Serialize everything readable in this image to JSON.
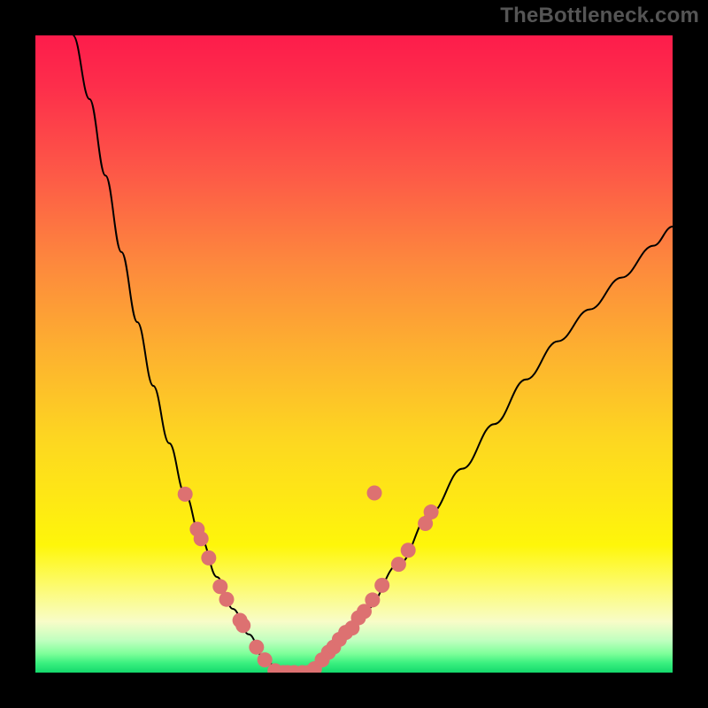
{
  "watermark": {
    "text": "TheBottleneck.com"
  },
  "chart_data": {
    "type": "line",
    "title": "",
    "xlabel": "",
    "ylabel": "",
    "ylim": [
      0,
      100
    ],
    "series": [
      {
        "name": "left-curve",
        "x": [
          0.059,
          0.085,
          0.11,
          0.135,
          0.16,
          0.185,
          0.21,
          0.235,
          0.26,
          0.285,
          0.31,
          0.335,
          0.36,
          0.386
        ],
        "values": [
          100,
          90,
          78,
          66,
          55,
          45,
          36,
          28,
          21,
          15,
          10,
          6,
          2,
          0
        ]
      },
      {
        "name": "right-curve",
        "x": [
          0.43,
          0.47,
          0.52,
          0.57,
          0.62,
          0.67,
          0.72,
          0.77,
          0.82,
          0.87,
          0.92,
          0.97,
          1.0
        ],
        "values": [
          0,
          4,
          10,
          17,
          25,
          32,
          39,
          46,
          52,
          57,
          62,
          67,
          70
        ]
      },
      {
        "name": "bottom-flat",
        "x": [
          0.386,
          0.43
        ],
        "values": [
          0,
          0
        ]
      }
    ],
    "markers_left": [
      {
        "x": 0.235,
        "y": 28
      },
      {
        "x": 0.254,
        "y": 22.5
      },
      {
        "x": 0.26,
        "y": 21
      },
      {
        "x": 0.272,
        "y": 18
      },
      {
        "x": 0.29,
        "y": 13.5
      },
      {
        "x": 0.3,
        "y": 11.5
      },
      {
        "x": 0.321,
        "y": 8.2
      },
      {
        "x": 0.326,
        "y": 7.4
      },
      {
        "x": 0.347,
        "y": 4
      },
      {
        "x": 0.36,
        "y": 2
      }
    ],
    "markers_bottom": [
      {
        "x": 0.376,
        "y": 0.3
      },
      {
        "x": 0.389,
        "y": 0
      },
      {
        "x": 0.396,
        "y": 0
      },
      {
        "x": 0.406,
        "y": 0
      },
      {
        "x": 0.419,
        "y": 0
      },
      {
        "x": 0.428,
        "y": 0
      },
      {
        "x": 0.438,
        "y": 0.6
      },
      {
        "x": 0.45,
        "y": 2
      }
    ],
    "markers_right": [
      {
        "x": 0.46,
        "y": 3.2
      },
      {
        "x": 0.468,
        "y": 4
      },
      {
        "x": 0.477,
        "y": 5.2
      },
      {
        "x": 0.487,
        "y": 6.3
      },
      {
        "x": 0.497,
        "y": 7
      },
      {
        "x": 0.507,
        "y": 8.6
      },
      {
        "x": 0.516,
        "y": 9.6
      },
      {
        "x": 0.529,
        "y": 11.4
      },
      {
        "x": 0.544,
        "y": 13.7
      },
      {
        "x": 0.57,
        "y": 17
      },
      {
        "x": 0.585,
        "y": 19.2
      },
      {
        "x": 0.612,
        "y": 23.4
      },
      {
        "x": 0.621,
        "y": 25.2
      },
      {
        "x": 0.532,
        "y": 28.2
      }
    ],
    "colors": {
      "marker": "#dd7171",
      "curve": "#000000"
    }
  }
}
